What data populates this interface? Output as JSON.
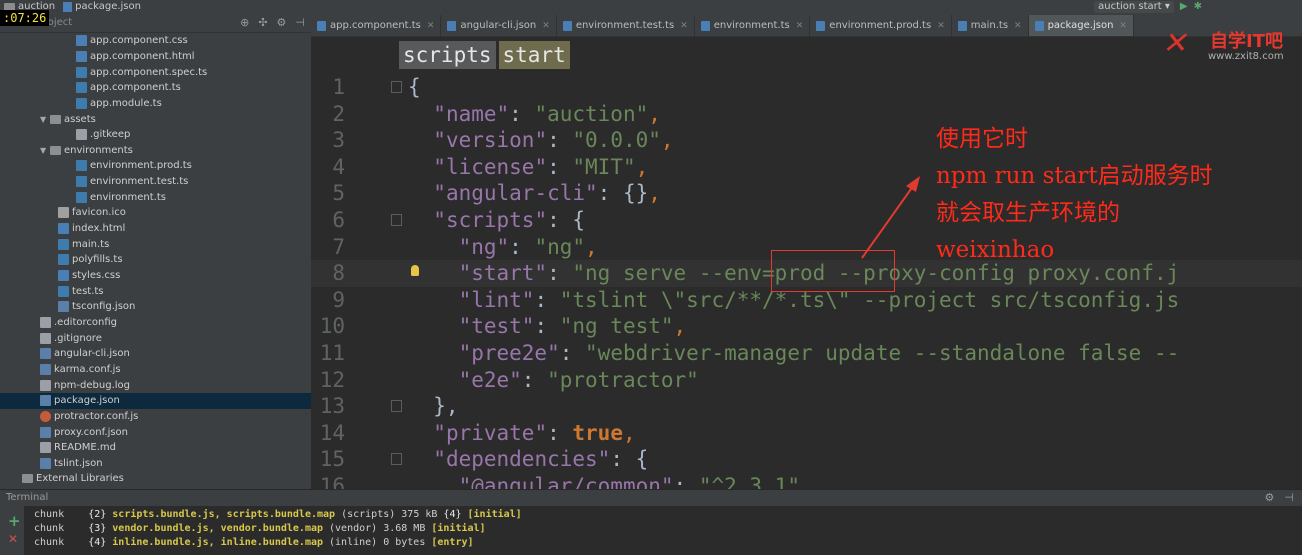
{
  "topbar": {
    "project": "auction",
    "file": "package.json",
    "timer": ":07:26",
    "run_config": "auction start"
  },
  "project_panel": {
    "title": "Project",
    "items": [
      {
        "label": "app.component.css",
        "icon": "css-file-icon",
        "indent": 4
      },
      {
        "label": "app.component.html",
        "icon": "html-file-icon",
        "indent": 4
      },
      {
        "label": "app.component.spec.ts",
        "icon": "ts-file-icon",
        "indent": 4
      },
      {
        "label": "app.component.ts",
        "icon": "ts-file-icon",
        "indent": 4
      },
      {
        "label": "app.module.ts",
        "icon": "ts-file-icon",
        "indent": 4
      },
      {
        "label": "assets",
        "icon": "folder-icon",
        "indent": 2,
        "expanded": true
      },
      {
        "label": ".gitkeep",
        "icon": "file-icon",
        "indent": 4
      },
      {
        "label": "environments",
        "icon": "folder-icon",
        "indent": 2,
        "expanded": true
      },
      {
        "label": "environment.prod.ts",
        "icon": "ts-file-icon",
        "indent": 4
      },
      {
        "label": "environment.test.ts",
        "icon": "ts-file-icon",
        "indent": 4
      },
      {
        "label": "environment.ts",
        "icon": "ts-file-icon",
        "indent": 4
      },
      {
        "label": "favicon.ico",
        "icon": "image-file-icon",
        "indent": 3
      },
      {
        "label": "index.html",
        "icon": "html-file-icon",
        "indent": 3
      },
      {
        "label": "main.ts",
        "icon": "ts-file-icon",
        "indent": 3
      },
      {
        "label": "polyfills.ts",
        "icon": "ts-file-icon",
        "indent": 3
      },
      {
        "label": "styles.css",
        "icon": "css-file-icon",
        "indent": 3
      },
      {
        "label": "test.ts",
        "icon": "ts-file-icon",
        "indent": 3
      },
      {
        "label": "tsconfig.json",
        "icon": "json-file-icon",
        "indent": 3
      },
      {
        "label": ".editorconfig",
        "icon": "file-icon",
        "indent": 1
      },
      {
        "label": ".gitignore",
        "icon": "file-icon",
        "indent": 1
      },
      {
        "label": "angular-cli.json",
        "icon": "json-file-icon",
        "indent": 1
      },
      {
        "label": "karma.conf.js",
        "icon": "js-file-icon",
        "indent": 1
      },
      {
        "label": "npm-debug.log",
        "icon": "file-icon",
        "indent": 1
      },
      {
        "label": "package.json",
        "icon": "json-file-icon",
        "indent": 1,
        "selected": true
      },
      {
        "label": "protractor.conf.js",
        "icon": "protractor-file-icon",
        "indent": 1
      },
      {
        "label": "proxy.conf.json",
        "icon": "json-file-icon",
        "indent": 1
      },
      {
        "label": "README.md",
        "icon": "file-icon",
        "indent": 1
      },
      {
        "label": "tslint.json",
        "icon": "json-file-icon",
        "indent": 1
      },
      {
        "label": "External Libraries",
        "icon": "library-icon",
        "indent": 0
      }
    ]
  },
  "tabs": [
    {
      "label": "app.component.ts"
    },
    {
      "label": "angular-cli.json"
    },
    {
      "label": "environment.test.ts"
    },
    {
      "label": "environment.ts"
    },
    {
      "label": "environment.prod.ts"
    },
    {
      "label": "main.ts"
    },
    {
      "label": "package.json",
      "active": true
    }
  ],
  "logo": {
    "brand": "自学IT吧",
    "site": "www.zxit8.com"
  },
  "breadcrumb": {
    "first": "scripts",
    "second": "start"
  },
  "editor": {
    "lines": [
      {
        "n": "1",
        "fold": true,
        "parts": [
          [
            "p",
            "{"
          ]
        ]
      },
      {
        "n": "2",
        "parts": [
          [
            "p",
            "  "
          ],
          [
            "k",
            "\"name\""
          ],
          [
            "p",
            ": "
          ],
          [
            "s",
            "\"auction\""
          ],
          [
            "o",
            ","
          ]
        ]
      },
      {
        "n": "3",
        "parts": [
          [
            "p",
            "  "
          ],
          [
            "k",
            "\"version\""
          ],
          [
            "p",
            ": "
          ],
          [
            "s",
            "\"0.0.0\""
          ],
          [
            "o",
            ","
          ]
        ]
      },
      {
        "n": "4",
        "parts": [
          [
            "p",
            "  "
          ],
          [
            "k",
            "\"license\""
          ],
          [
            "p",
            ": "
          ],
          [
            "s",
            "\"MIT\""
          ],
          [
            "o",
            ","
          ]
        ]
      },
      {
        "n": "5",
        "parts": [
          [
            "p",
            "  "
          ],
          [
            "k",
            "\"angular-cli\""
          ],
          [
            "p",
            ": {}"
          ],
          [
            "o",
            ","
          ]
        ]
      },
      {
        "n": "6",
        "fold": true,
        "parts": [
          [
            "p",
            "  "
          ],
          [
            "k",
            "\"scripts\""
          ],
          [
            "p",
            ": {"
          ]
        ]
      },
      {
        "n": "7",
        "parts": [
          [
            "p",
            "    "
          ],
          [
            "k",
            "\"ng\""
          ],
          [
            "p",
            ": "
          ],
          [
            "s",
            "\"ng\""
          ],
          [
            "o",
            ","
          ]
        ]
      },
      {
        "n": "8",
        "current": true,
        "bulb": true,
        "parts": [
          [
            "p",
            "    "
          ],
          [
            "k",
            "\"start\""
          ],
          [
            "p",
            ": "
          ],
          [
            "s",
            "\"ng serve --env=prod --proxy-config proxy.conf.j"
          ]
        ]
      },
      {
        "n": "9",
        "parts": [
          [
            "p",
            "    "
          ],
          [
            "k",
            "\"lint\""
          ],
          [
            "p",
            ": "
          ],
          [
            "s",
            "\"tslint \\\"src/**/*.ts\\\" --project src/tsconfig.js"
          ]
        ]
      },
      {
        "n": "10",
        "parts": [
          [
            "p",
            "    "
          ],
          [
            "k",
            "\"test\""
          ],
          [
            "p",
            ": "
          ],
          [
            "s",
            "\"ng test\""
          ],
          [
            "o",
            ","
          ]
        ]
      },
      {
        "n": "11",
        "parts": [
          [
            "p",
            "    "
          ],
          [
            "k",
            "\"pree2e\""
          ],
          [
            "p",
            ": "
          ],
          [
            "s",
            "\"webdriver-manager update --standalone false --"
          ]
        ]
      },
      {
        "n": "12",
        "parts": [
          [
            "p",
            "    "
          ],
          [
            "k",
            "\"e2e\""
          ],
          [
            "p",
            ": "
          ],
          [
            "s",
            "\"protractor\""
          ]
        ]
      },
      {
        "n": "13",
        "fold": true,
        "parts": [
          [
            "p",
            "  },"
          ]
        ]
      },
      {
        "n": "14",
        "parts": [
          [
            "p",
            "  "
          ],
          [
            "k",
            "\"private\""
          ],
          [
            "p",
            ": "
          ],
          [
            "kw",
            "true"
          ],
          [
            "o",
            ","
          ]
        ]
      },
      {
        "n": "15",
        "fold": true,
        "parts": [
          [
            "p",
            "  "
          ],
          [
            "k",
            "\"dependencies\""
          ],
          [
            "p",
            ": {"
          ]
        ]
      },
      {
        "n": "16",
        "parts": [
          [
            "p",
            "    "
          ],
          [
            "k",
            "\"@angular/common\""
          ],
          [
            "p",
            ": "
          ],
          [
            "s",
            "\"^2.3.1\""
          ]
        ]
      }
    ]
  },
  "annotation": {
    "line1": "使用它时",
    "line2": "npm run start启动服务时",
    "line3": "就会取生产环境的",
    "line4": "weixinhao"
  },
  "terminal": {
    "title": "Terminal",
    "lines": [
      {
        "a": "chunk    ",
        "b": "{2} ",
        "c": "scripts.bundle.js, scripts.bundle.map",
        "d": " (scripts) 375 kB ",
        "e": "{4} ",
        "f": "[initial]"
      },
      {
        "a": "chunk    ",
        "b": "{3} ",
        "c": "vendor.bundle.js, vendor.bundle.map",
        "d": " (vendor) 3.68 MB ",
        "e": "",
        "f": "[initial]"
      },
      {
        "a": "chunk    ",
        "b": "{4} ",
        "c": "inline.bundle.js, inline.bundle.map",
        "d": " (inline) 0 bytes ",
        "e": "",
        "f": "[entry]"
      }
    ]
  },
  "colors": {
    "accent_red": "#e23a2e",
    "string": "#6a8759",
    "key": "#9876aa",
    "keyword": "#cc7832"
  }
}
